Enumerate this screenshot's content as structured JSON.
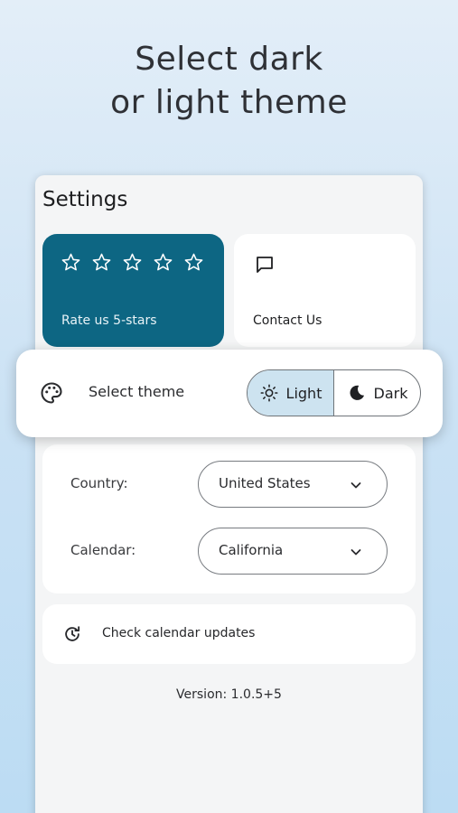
{
  "headline": {
    "line1": "Select dark",
    "line2": "or light theme"
  },
  "settings": {
    "title": "Settings",
    "rate": {
      "label": "Rate us 5-stars",
      "stars": 5,
      "icon": "star-outline-icon"
    },
    "contact": {
      "label": "Contact Us",
      "icon": "chat-bubble-icon"
    },
    "theme": {
      "label": "Select theme",
      "icon": "palette-icon",
      "options": [
        {
          "label": "Light",
          "icon": "sun-icon",
          "selected": true
        },
        {
          "label": "Dark",
          "icon": "moon-icon",
          "selected": false
        }
      ]
    },
    "country": {
      "label": "Country:",
      "value": "United States"
    },
    "calendar": {
      "label": "Calendar:",
      "value": "California"
    },
    "updates": {
      "label": "Check calendar updates",
      "icon": "refresh-clock-icon"
    },
    "version": "Version: 1.0.5+5"
  },
  "colors": {
    "accent": "#0d6683",
    "selected_segment": "#cde3f0",
    "background_top": "#e3eef8",
    "background_bottom": "#bcdcf3"
  }
}
